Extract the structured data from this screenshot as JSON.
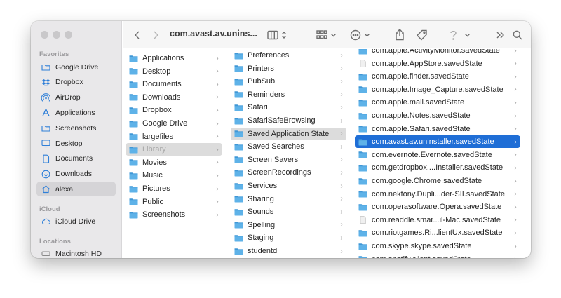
{
  "window": {
    "path_title": "com.avast.av.unins...",
    "colors": {
      "selection": "#1f6ed6",
      "folder": "#5eb2e8",
      "sidebar": "#e9e8ea"
    }
  },
  "sidebar": {
    "favorites_label": "Favorites",
    "favorites": [
      {
        "label": "Google Drive",
        "icon": "folder-icon"
      },
      {
        "label": "Dropbox",
        "icon": "dropbox-icon"
      },
      {
        "label": "AirDrop",
        "icon": "airdrop-icon"
      },
      {
        "label": "Applications",
        "icon": "applications-icon"
      },
      {
        "label": "Screenshots",
        "icon": "folder-icon"
      },
      {
        "label": "Desktop",
        "icon": "desktop-icon"
      },
      {
        "label": "Documents",
        "icon": "document-icon"
      },
      {
        "label": "Downloads",
        "icon": "downloads-icon"
      },
      {
        "label": "alexa",
        "icon": "home-icon",
        "selected": true
      }
    ],
    "icloud_label": "iCloud",
    "icloud": [
      {
        "label": "iCloud Drive",
        "icon": "cloud-icon"
      }
    ],
    "locations_label": "Locations",
    "locations": [
      {
        "label": "Macintosh HD",
        "icon": "disk-icon"
      }
    ]
  },
  "column1": [
    {
      "label": "Applications",
      "type": "folder"
    },
    {
      "label": "Desktop",
      "type": "folder"
    },
    {
      "label": "Documents",
      "type": "folder"
    },
    {
      "label": "Downloads",
      "type": "folder"
    },
    {
      "label": "Dropbox",
      "type": "folder"
    },
    {
      "label": "Google Drive",
      "type": "folder"
    },
    {
      "label": "largefiles",
      "type": "folder"
    },
    {
      "label": "Library",
      "type": "folder",
      "state": "highlight",
      "dim": true
    },
    {
      "label": "Movies",
      "type": "folder"
    },
    {
      "label": "Music",
      "type": "folder"
    },
    {
      "label": "Pictures",
      "type": "folder"
    },
    {
      "label": "Public",
      "type": "folder"
    },
    {
      "label": "Screenshots",
      "type": "folder"
    }
  ],
  "column2": [
    {
      "label": "Preferences",
      "type": "folder"
    },
    {
      "label": "Printers",
      "type": "folder"
    },
    {
      "label": "PubSub",
      "type": "folder"
    },
    {
      "label": "Reminders",
      "type": "folder"
    },
    {
      "label": "Safari",
      "type": "folder"
    },
    {
      "label": "SafariSafeBrowsing",
      "type": "folder"
    },
    {
      "label": "Saved Application State",
      "type": "folder",
      "state": "highlight"
    },
    {
      "label": "Saved Searches",
      "type": "folder"
    },
    {
      "label": "Screen Savers",
      "type": "folder"
    },
    {
      "label": "ScreenRecordings",
      "type": "folder"
    },
    {
      "label": "Services",
      "type": "folder"
    },
    {
      "label": "Sharing",
      "type": "folder"
    },
    {
      "label": "Sounds",
      "type": "folder"
    },
    {
      "label": "Spelling",
      "type": "folder"
    },
    {
      "label": "Staging",
      "type": "folder"
    },
    {
      "label": "studentd",
      "type": "folder"
    }
  ],
  "column3": [
    {
      "label": "com.apple.ActivityMonitor.savedState",
      "type": "folder"
    },
    {
      "label": "com.apple.AppStore.savedState",
      "type": "doc"
    },
    {
      "label": "com.apple.finder.savedState",
      "type": "folder"
    },
    {
      "label": "com.apple.Image_Capture.savedState",
      "type": "folder"
    },
    {
      "label": "com.apple.mail.savedState",
      "type": "folder"
    },
    {
      "label": "com.apple.Notes.savedState",
      "type": "folder"
    },
    {
      "label": "com.apple.Safari.savedState",
      "type": "folder"
    },
    {
      "label": "com.avast.av.uninstaller.savedState",
      "type": "folder",
      "state": "selected"
    },
    {
      "label": "com.evernote.Evernote.savedState",
      "type": "folder"
    },
    {
      "label": "com.getdropbox....Installer.savedState",
      "type": "folder"
    },
    {
      "label": "com.google.Chrome.savedState",
      "type": "folder"
    },
    {
      "label": "com.nektony.Dupli...der-SII.savedState",
      "type": "folder"
    },
    {
      "label": "com.operasoftware.Opera.savedState",
      "type": "folder"
    },
    {
      "label": "com.readdle.smar...il-Mac.savedState",
      "type": "doc"
    },
    {
      "label": "com.riotgames.Ri...lientUx.savedState",
      "type": "folder"
    },
    {
      "label": "com.skype.skype.savedState",
      "type": "folder"
    },
    {
      "label": "com.spotify.client.savedState",
      "type": "folder"
    }
  ]
}
